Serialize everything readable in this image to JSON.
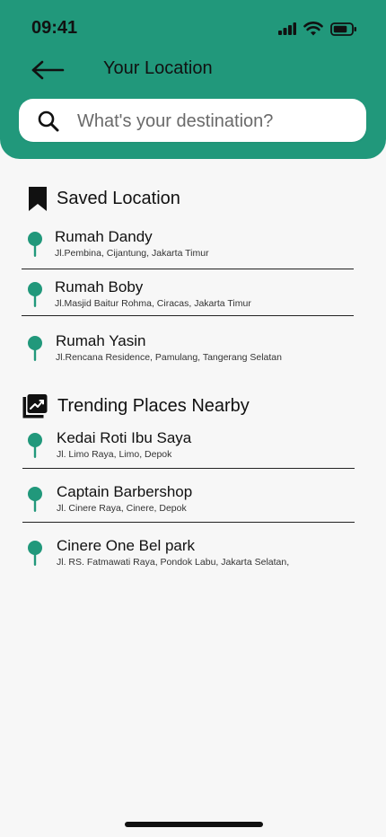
{
  "status_bar": {
    "time": "09:41"
  },
  "header": {
    "title": "Your Location"
  },
  "search": {
    "placeholder": "What's your destination?",
    "value": ""
  },
  "saved": {
    "heading": "Saved Location",
    "items": [
      {
        "name": "Rumah Dandy",
        "address": "Jl.Pembina, Cijantung, Jakarta Timur"
      },
      {
        "name": "Rumah Boby",
        "address": "Jl.Masjid Baitur Rohma, Ciracas, Jakarta Timur"
      },
      {
        "name": "Rumah Yasin",
        "address": "Jl.Rencana Residence, Pamulang, Tangerang Selatan"
      }
    ]
  },
  "trending": {
    "heading": "Trending Places Nearby",
    "items": [
      {
        "name": "Kedai Roti Ibu Saya",
        "address": "Jl. Limo Raya, Limo, Depok"
      },
      {
        "name": "Captain Barbershop",
        "address": "Jl. Cinere Raya, Cinere, Depok"
      },
      {
        "name": "Cinere One Bel park",
        "address": "Jl. RS. Fatmawati Raya, Pondok Labu, Jakarta Selatan,"
      }
    ]
  },
  "colors": {
    "accent": "#21987b",
    "background": "#f7f7f7",
    "text": "#111111"
  },
  "icons": {
    "back": "arrow-left-icon",
    "search": "search-icon",
    "saved": "bookmark-icon",
    "trending": "trending-chart-icon",
    "pin": "location-pin-icon"
  }
}
